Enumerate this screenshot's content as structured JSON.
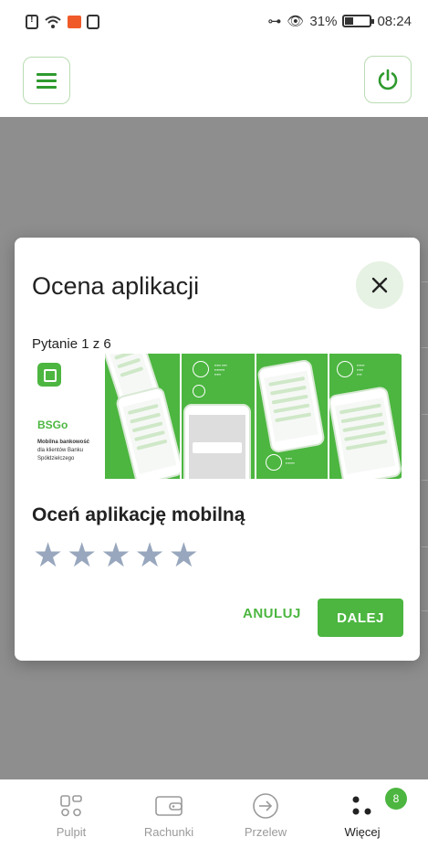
{
  "statusbar": {
    "battery_percent": "31%",
    "time": "08:24",
    "icons": [
      "sim-alert-icon",
      "wifi-icon",
      "mail-notification-icon",
      "cast-icon",
      "vpn-key-icon",
      "eye-icon",
      "battery-icon"
    ]
  },
  "header": {
    "menu_icon": "hamburger-icon",
    "power_icon": "power-icon"
  },
  "modal": {
    "title": "Ocena aplikacji",
    "close_icon": "close-icon",
    "question_count": "Pytanie 1 z 6",
    "banner": {
      "app_name": "BSGo",
      "app_description_bold": "Mobilna bankowość",
      "app_description": "dla klientów Banku Spółdzielczego"
    },
    "rating_title": "Oceń aplikację mobilną",
    "rating": {
      "value": 0,
      "max": 5
    },
    "cancel_label": "ANULUJ",
    "next_label": "DALEJ"
  },
  "bottom_nav": {
    "items": [
      {
        "label": "Pulpit",
        "icon": "dashboard-icon",
        "active": false
      },
      {
        "label": "Rachunki",
        "icon": "wallet-icon",
        "active": false
      },
      {
        "label": "Przelew",
        "icon": "arrow-right-circle-icon",
        "active": false
      },
      {
        "label": "Więcej",
        "icon": "more-dots-icon",
        "active": true,
        "badge": "8"
      }
    ]
  },
  "colors": {
    "brand_green": "#4cb640",
    "star_inactive": "#98a7bd",
    "backdrop": "#8e8e8e"
  }
}
